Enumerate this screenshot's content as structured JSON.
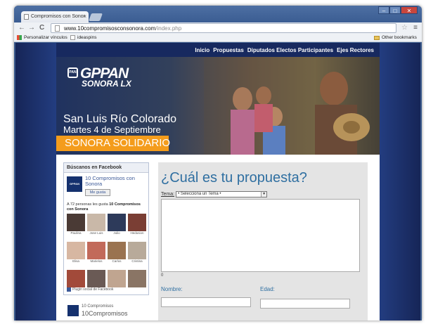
{
  "browser": {
    "tab_title": "Compromisos con Sonor",
    "tab_close": "×",
    "window_buttons": {
      "minimize": "–",
      "maximize": "□",
      "close": "✕"
    },
    "nav_icons": {
      "back": "←",
      "forward": "→",
      "reload": "C"
    },
    "url_domain": "www.10compromisosconsonora.com",
    "url_path": "/index.php",
    "star": "☆",
    "wrench": "≡",
    "bookmarks": [
      {
        "label": "Personalizar vínculos",
        "icon": "windows-icon"
      },
      {
        "label": "ideaspins",
        "icon": "page-icon"
      }
    ],
    "other_bookmarks": "Other bookmarks"
  },
  "nav": {
    "items": [
      "Inicio",
      "Propuestas",
      "Diputados Electos Participantes",
      "Ejes Rectores"
    ]
  },
  "banner": {
    "logo_badge": "PAN",
    "logo_main": "GPPAN",
    "logo_sub": "SONORA LX",
    "city": "San Luis Río Colorado",
    "date": "Martes 4 de Septiembre",
    "tagline": "SONORA SOLIDARIO"
  },
  "facebook": {
    "header": "Búscanos en Facebook",
    "page_thumb": "GPPAN",
    "page_name": "10 Compromisos con Sonora",
    "like_label": "Me gusta",
    "count_text": "A 72 personas les gusta",
    "count_page": "10 Compromisos con Sonora",
    "fans": [
      {
        "name": "Paulina",
        "color": "#4a3a35"
      },
      {
        "name": "Jose Luis",
        "color": "#c9b8a8"
      },
      {
        "name": "Julio",
        "color": "#2d3a5a"
      },
      {
        "name": "Hedusion",
        "color": "#7a3e34"
      },
      {
        "name": "Elisa",
        "color": "#d7b7a2"
      },
      {
        "name": "Marielos",
        "color": "#c26a5a"
      },
      {
        "name": "Carlos",
        "color": "#9a7350"
      },
      {
        "name": "Cristina",
        "color": "#b8aa9a"
      },
      {
        "name": "",
        "color": "#a24a3a"
      },
      {
        "name": "",
        "color": "#6a5a55"
      },
      {
        "name": "",
        "color": "#c0a590"
      },
      {
        "name": "",
        "color": "#8a7565"
      }
    ],
    "plugin_label": "Plugin social de Facebook"
  },
  "sidebar_promo": {
    "line1": "10 Compromisos",
    "line2": "10Compromisos"
  },
  "form": {
    "heading": "¿Cuál es tu propuesta?",
    "tema_label": "Tema:",
    "tema_value": "• Selecciona un Tema •",
    "select_arrow": "▼",
    "counter": "0",
    "nombre_label": "Nombre:",
    "edad_label": "Edad:"
  }
}
